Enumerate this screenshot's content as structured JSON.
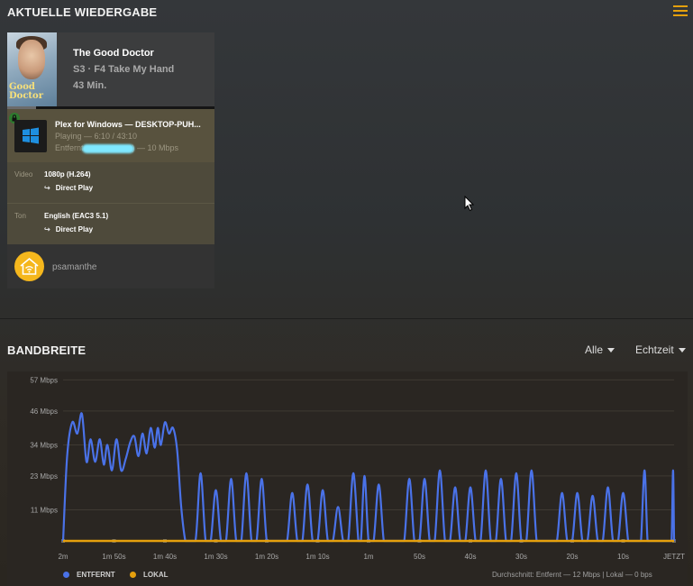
{
  "now_playing": {
    "section_title": "AKTUELLE WIEDERGABE",
    "poster_logo": "Good Doctor",
    "title": "The Good Doctor",
    "subtitle": "S3 · F4 Take My Hand",
    "duration": "43 Min.",
    "progress_fraction": 0.14,
    "player": {
      "name": "Plex for Windows",
      "separator": " — ",
      "device": "DESKTOP-PUH...",
      "status": "Playing — 6:10 / 43:10",
      "location_prefix": "Entfernt",
      "location_suffix": ") — 10 Mbps",
      "icon": "windows-icon",
      "secure_icon": "lock-icon"
    },
    "video": {
      "label": "Video",
      "value": "1080p (H.264)",
      "decision": "Direct Play"
    },
    "audio": {
      "label": "Ton",
      "value": "English (EAC3 5.1)",
      "decision": "Direct Play"
    },
    "user": {
      "name": "psamanthe",
      "avatar": "home-wifi-icon"
    }
  },
  "bandwidth": {
    "section_title": "BANDBREITE",
    "filter_label": "Alle",
    "range_label": "Echtzeit",
    "legend": {
      "remote": "ENTFERNT",
      "local": "LOKAL"
    },
    "average": "Durchschnitt: Entfernt — 12 Mbps | Lokal — 0 bps",
    "colors": {
      "remote": "#4a72e8",
      "local": "#e5a00d"
    }
  },
  "chart_data": {
    "type": "area",
    "xlabel": "",
    "ylabel": "",
    "y_ticks": [
      "57 Mbps",
      "46 Mbps",
      "34 Mbps",
      "23 Mbps",
      "11 Mbps"
    ],
    "y_tick_values": [
      57,
      46,
      34,
      23,
      11
    ],
    "ylim": [
      0,
      60
    ],
    "x_ticks": [
      "2m",
      "1m 50s",
      "1m 40s",
      "1m 30s",
      "1m 20s",
      "1m 10s",
      "1m",
      "50s",
      "40s",
      "30s",
      "20s",
      "10s",
      "JETZT"
    ],
    "x_tick_seconds": [
      120,
      110,
      100,
      90,
      80,
      70,
      60,
      50,
      40,
      30,
      20,
      10,
      0
    ],
    "grid": true,
    "series": [
      {
        "name": "ENTFERNT",
        "seconds_ago": [
          120,
          119.2,
          118.2,
          117.2,
          116.3,
          115.4,
          114.6,
          113.7,
          112.8,
          112,
          111.3,
          110.4,
          109.5,
          108.6,
          107.7,
          106.8,
          106,
          105.2,
          104.4,
          103.6,
          102.8,
          102,
          101.4,
          100.8,
          100,
          99.2,
          98.4,
          97.6,
          96.8,
          96,
          95.6,
          94,
          93,
          92,
          91,
          90,
          89,
          88,
          87,
          86,
          85,
          84,
          83,
          82,
          81,
          80,
          79,
          78,
          77,
          76,
          75,
          74,
          73,
          72,
          71,
          70,
          69,
          68,
          67,
          66,
          65,
          64,
          63,
          62,
          61.5,
          60.8,
          60,
          59,
          58,
          57,
          56,
          55,
          54,
          53,
          52,
          51,
          50,
          49,
          48,
          47,
          46,
          45,
          44,
          43,
          42,
          41,
          40,
          39,
          38,
          37,
          36,
          35,
          34,
          33,
          32,
          31,
          30,
          29,
          28,
          27,
          26,
          25,
          24,
          23,
          22,
          21,
          20,
          19,
          18,
          17,
          16,
          15,
          14,
          13,
          12,
          11,
          10,
          9,
          8.2,
          7.6,
          7,
          6.5,
          5.8,
          5.2,
          4.5,
          3.5,
          2.5,
          1.5,
          1,
          0.5,
          0.2,
          0
        ],
        "values": [
          0,
          30,
          42,
          38,
          45,
          28,
          36,
          28,
          36,
          27,
          34,
          25,
          36,
          25,
          29,
          35,
          37,
          30,
          38,
          31,
          40,
          33,
          40,
          34,
          42,
          38,
          40,
          32,
          12,
          0,
          0,
          0,
          24,
          0,
          0,
          18,
          0,
          0,
          22,
          0,
          0,
          24,
          0,
          0,
          22,
          0,
          0,
          0,
          0,
          0,
          17,
          0,
          0,
          20,
          0,
          0,
          18,
          0,
          0,
          12,
          0,
          0,
          24,
          0,
          0,
          23,
          0,
          0,
          20,
          0,
          0,
          0,
          0,
          0,
          22,
          0,
          0,
          22,
          0,
          0,
          25,
          0,
          0,
          19,
          0,
          0,
          19,
          0,
          0,
          25,
          0,
          0,
          22,
          0,
          0,
          24,
          0,
          0,
          25,
          0,
          0,
          0,
          0,
          0,
          17,
          0,
          0,
          17,
          0,
          0,
          16,
          0,
          0,
          19,
          0,
          0,
          17,
          0,
          0,
          0,
          0,
          0,
          25,
          0,
          0,
          0,
          0,
          0,
          0,
          0,
          25,
          0
        ]
      },
      {
        "name": "LOKAL",
        "seconds_ago": [
          120,
          0
        ],
        "values": [
          0,
          0
        ]
      }
    ]
  }
}
